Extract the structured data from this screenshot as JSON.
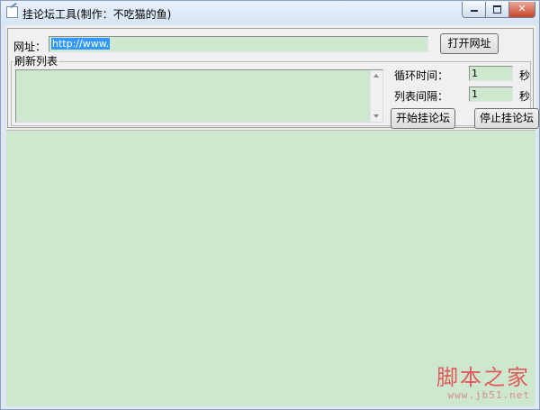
{
  "window": {
    "title": "挂论坛工具(制作：不吃猫的鱼)",
    "controls": {
      "minimize": "",
      "maximize": "",
      "close": "✕"
    }
  },
  "url_row": {
    "label": "网址：",
    "value": "http://www.",
    "button": "打开网址"
  },
  "refresh_list": {
    "title": "刷新列表",
    "items": []
  },
  "settings": {
    "cycle_label": "循环时间：",
    "cycle_value": "1",
    "cycle_unit": "秒",
    "interval_label": "列表间隔：",
    "interval_value": "1",
    "interval_unit": "秒"
  },
  "actions": {
    "start": "开始挂论坛",
    "stop": "停止挂论坛"
  },
  "watermark": {
    "main": "脚本之家",
    "sub": "www.jb51.net"
  },
  "colors": {
    "field_bg": "#cde8ce",
    "titlebar": "#d6e3f3",
    "close_button": "#c9432a",
    "selection": "#3399ff"
  }
}
